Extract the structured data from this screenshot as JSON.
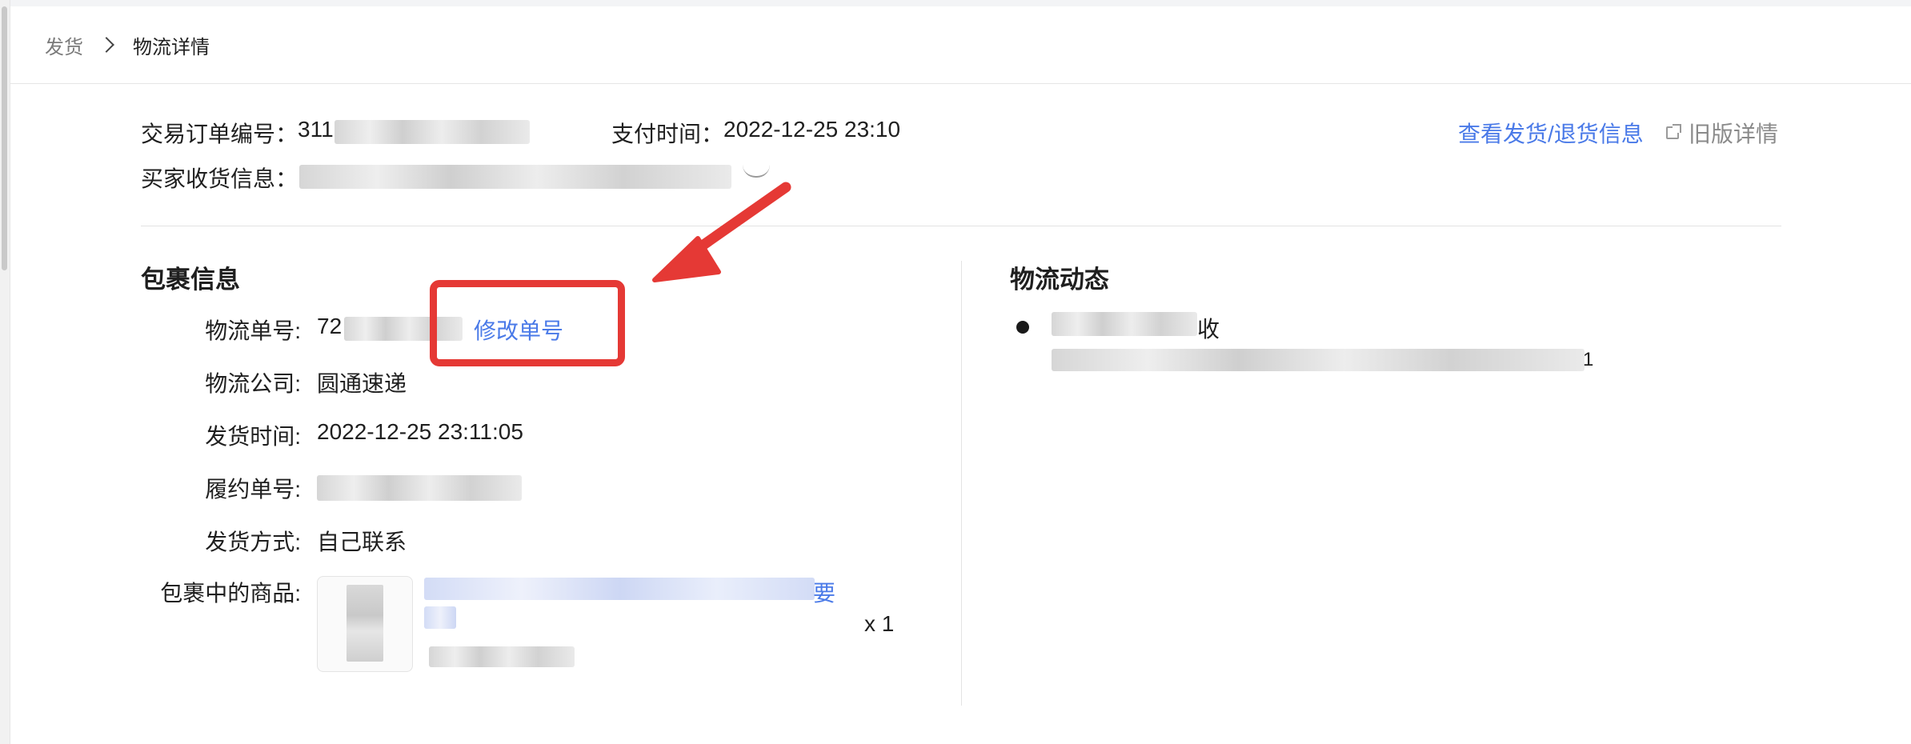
{
  "breadcrumb": {
    "parent": "发货",
    "current": "物流详情"
  },
  "order": {
    "order_no_label": "交易订单编号：",
    "order_no_visible": "311",
    "pay_time_label": "支付时间：",
    "pay_time": "2022-12-25 23:10",
    "buyer_label": "买家收货信息："
  },
  "header_links": {
    "view_shipping": "查看发货/退货信息",
    "old_detail": "旧版详情"
  },
  "package": {
    "title": "包裹信息",
    "tracking_label": "物流单号:",
    "tracking_visible": "72",
    "modify_link": "修改单号",
    "company_label": "物流公司:",
    "company": "圆通速递",
    "ship_time_label": "发货时间:",
    "ship_time": "2022-12-25 23:11:05",
    "fulfill_label": "履约单号:",
    "method_label": "发货方式:",
    "method": "自己联系",
    "goods_label": "包裹中的商品:",
    "goods_title_tail": "要",
    "quantity": "x 1"
  },
  "logistics": {
    "title": "物流动态",
    "status_tail": "收",
    "detail_tail": "1"
  },
  "colors": {
    "link": "#4a7ae8",
    "annotation": "#e53935"
  },
  "icons": [
    "chevron-right-icon",
    "external-link-icon",
    "eye-closed-icon",
    "arrow-annotation-icon"
  ]
}
